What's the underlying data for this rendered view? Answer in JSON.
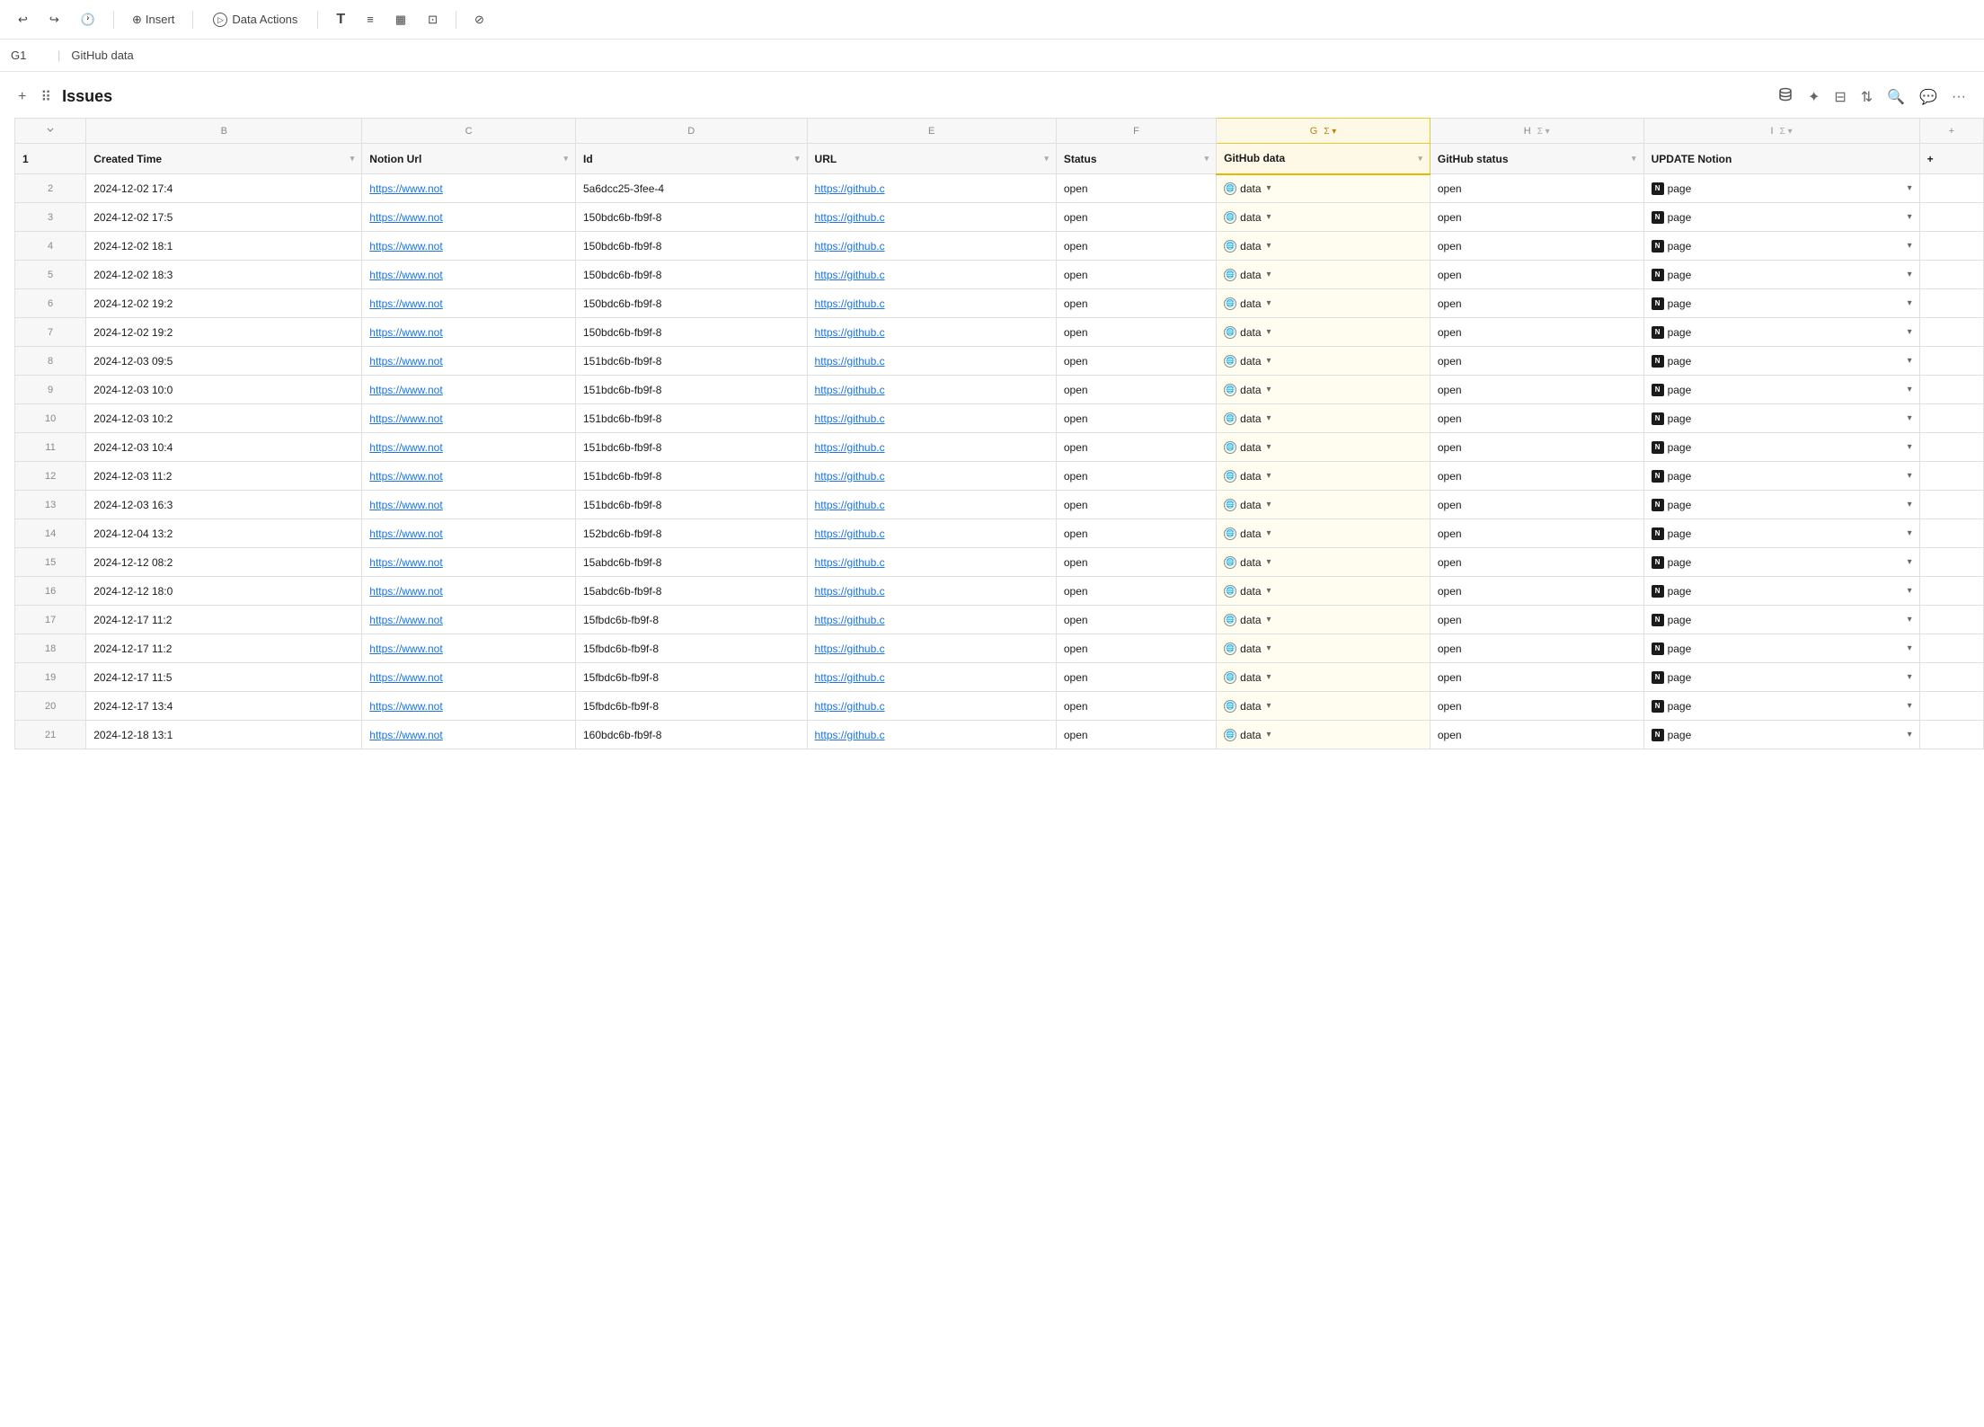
{
  "toolbar": {
    "undo_label": "undo",
    "redo_label": "redo",
    "history_label": "history",
    "insert_label": "Insert",
    "data_actions_label": "Data Actions",
    "text_icon": "T",
    "align_icon": "≡",
    "table_icon": "⊞",
    "image_icon": "⊡",
    "formula_icon": "⊘"
  },
  "formula_bar": {
    "cell_ref": "G1",
    "cell_value": "GitHub data"
  },
  "section": {
    "title": "Issues",
    "add_label": "+",
    "drag_label": "⠿"
  },
  "columns": {
    "letters": [
      "B",
      "C",
      "D",
      "E",
      "F",
      "G",
      "H",
      "I",
      "+"
    ],
    "headers": [
      "Created Time",
      "Notion Url",
      "Id",
      "URL",
      "Status",
      "GitHub data",
      "GitHub status",
      "UPDATE Notion"
    ]
  },
  "rows": [
    {
      "num": 2,
      "created": "2024-12-02 17:4",
      "notion_url": "https://www.not",
      "id": "5a6dcc25-3fee-4",
      "url": "https://github.c",
      "status": "open",
      "github_data": "data",
      "github_status": "open",
      "update_notion": "page"
    },
    {
      "num": 3,
      "created": "2024-12-02 17:5",
      "notion_url": "https://www.not",
      "id": "150bdc6b-fb9f-8",
      "url": "https://github.c",
      "status": "open",
      "github_data": "data",
      "github_status": "open",
      "update_notion": "page"
    },
    {
      "num": 4,
      "created": "2024-12-02 18:1",
      "notion_url": "https://www.not",
      "id": "150bdc6b-fb9f-8",
      "url": "https://github.c",
      "status": "open",
      "github_data": "data",
      "github_status": "open",
      "update_notion": "page"
    },
    {
      "num": 5,
      "created": "2024-12-02 18:3",
      "notion_url": "https://www.not",
      "id": "150bdc6b-fb9f-8",
      "url": "https://github.c",
      "status": "open",
      "github_data": "data",
      "github_status": "open",
      "update_notion": "page"
    },
    {
      "num": 6,
      "created": "2024-12-02 19:2",
      "notion_url": "https://www.not",
      "id": "150bdc6b-fb9f-8",
      "url": "https://github.c",
      "status": "open",
      "github_data": "data",
      "github_status": "open",
      "update_notion": "page"
    },
    {
      "num": 7,
      "created": "2024-12-02 19:2",
      "notion_url": "https://www.not",
      "id": "150bdc6b-fb9f-8",
      "url": "https://github.c",
      "status": "open",
      "github_data": "data",
      "github_status": "open",
      "update_notion": "page"
    },
    {
      "num": 8,
      "created": "2024-12-03 09:5",
      "notion_url": "https://www.not",
      "id": "151bdc6b-fb9f-8",
      "url": "https://github.c",
      "status": "open",
      "github_data": "data",
      "github_status": "open",
      "update_notion": "page"
    },
    {
      "num": 9,
      "created": "2024-12-03 10:0",
      "notion_url": "https://www.not",
      "id": "151bdc6b-fb9f-8",
      "url": "https://github.c",
      "status": "open",
      "github_data": "data",
      "github_status": "open",
      "update_notion": "page"
    },
    {
      "num": 10,
      "created": "2024-12-03 10:2",
      "notion_url": "https://www.not",
      "id": "151bdc6b-fb9f-8",
      "url": "https://github.c",
      "status": "open",
      "github_data": "data",
      "github_status": "open",
      "update_notion": "page"
    },
    {
      "num": 11,
      "created": "2024-12-03 10:4",
      "notion_url": "https://www.not",
      "id": "151bdc6b-fb9f-8",
      "url": "https://github.c",
      "status": "open",
      "github_data": "data",
      "github_status": "open",
      "update_notion": "page"
    },
    {
      "num": 12,
      "created": "2024-12-03 11:2",
      "notion_url": "https://www.not",
      "id": "151bdc6b-fb9f-8",
      "url": "https://github.c",
      "status": "open",
      "github_data": "data",
      "github_status": "open",
      "update_notion": "page"
    },
    {
      "num": 13,
      "created": "2024-12-03 16:3",
      "notion_url": "https://www.not",
      "id": "151bdc6b-fb9f-8",
      "url": "https://github.c",
      "status": "open",
      "github_data": "data",
      "github_status": "open",
      "update_notion": "page"
    },
    {
      "num": 14,
      "created": "2024-12-04 13:2",
      "notion_url": "https://www.not",
      "id": "152bdc6b-fb9f-8",
      "url": "https://github.c",
      "status": "open",
      "github_data": "data",
      "github_status": "open",
      "update_notion": "page"
    },
    {
      "num": 15,
      "created": "2024-12-12 08:2",
      "notion_url": "https://www.not",
      "id": "15abdc6b-fb9f-8",
      "url": "https://github.c",
      "status": "open",
      "github_data": "data",
      "github_status": "open",
      "update_notion": "page"
    },
    {
      "num": 16,
      "created": "2024-12-12 18:0",
      "notion_url": "https://www.not",
      "id": "15abdc6b-fb9f-8",
      "url": "https://github.c",
      "status": "open",
      "github_data": "data",
      "github_status": "open",
      "update_notion": "page"
    },
    {
      "num": 17,
      "created": "2024-12-17 11:2",
      "notion_url": "https://www.not",
      "id": "15fbdc6b-fb9f-8",
      "url": "https://github.c",
      "status": "open",
      "github_data": "data",
      "github_status": "open",
      "update_notion": "page"
    },
    {
      "num": 18,
      "created": "2024-12-17 11:2",
      "notion_url": "https://www.not",
      "id": "15fbdc6b-fb9f-8",
      "url": "https://github.c",
      "status": "open",
      "github_data": "data",
      "github_status": "open",
      "update_notion": "page"
    },
    {
      "num": 19,
      "created": "2024-12-17 11:5",
      "notion_url": "https://www.not",
      "id": "15fbdc6b-fb9f-8",
      "url": "https://github.c",
      "status": "open",
      "github_data": "data",
      "github_status": "open",
      "update_notion": "page"
    },
    {
      "num": 20,
      "created": "2024-12-17 13:4",
      "notion_url": "https://www.not",
      "id": "15fbdc6b-fb9f-8",
      "url": "https://github.c",
      "status": "open",
      "github_data": "data",
      "github_status": "open",
      "update_notion": "page"
    },
    {
      "num": 21,
      "created": "2024-12-18 13:1",
      "notion_url": "https://www.not",
      "id": "160bdc6b-fb9f-8",
      "url": "https://github.c",
      "status": "open",
      "github_data": "data",
      "github_status": "open",
      "update_notion": "page"
    }
  ]
}
